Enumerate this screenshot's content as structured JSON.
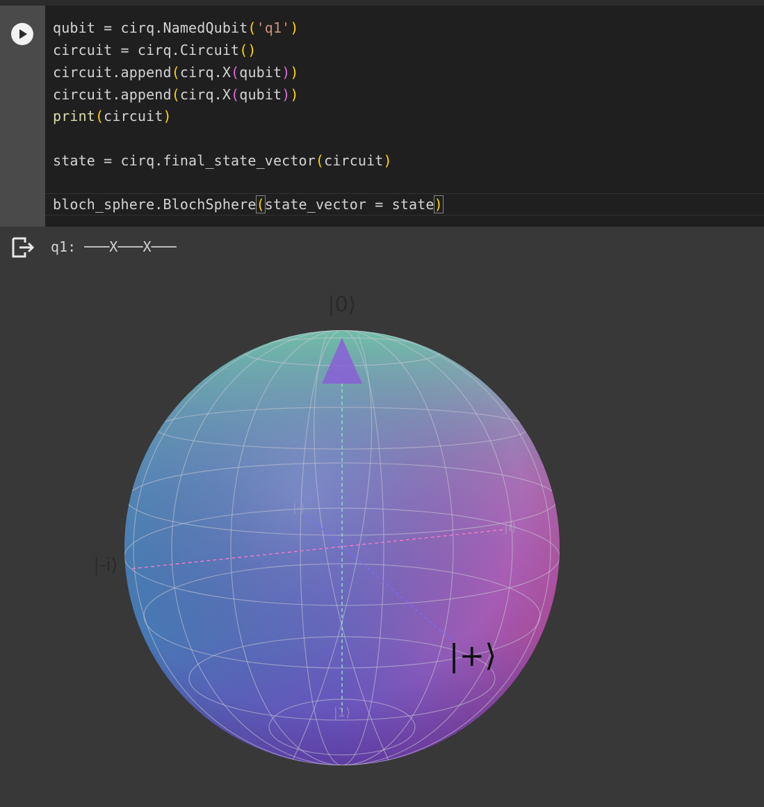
{
  "notebook": {
    "run_button_icon": "play-icon",
    "output_icon": "output-exit-icon"
  },
  "code": {
    "lines": [
      "qubit = cirq.NamedQubit('q1')",
      "circuit = cirq.Circuit()",
      "circuit.append(cirq.X(qubit))",
      "circuit.append(cirq.X(qubit))",
      "print(circuit)",
      "",
      "state = cirq.final_state_vector(circuit)",
      "",
      "bloch_sphere.BlochSphere(state_vector = state)"
    ]
  },
  "output": {
    "circuit_text": "q1: ───X───X───"
  },
  "bloch_sphere": {
    "labels": {
      "zero": "|0⟩",
      "plus": "|+⟩",
      "minus_i": "|-i⟩",
      "i": "|i⟩",
      "minus": "|-⟩",
      "one": "|1⟩"
    },
    "colors": {
      "top": "#6dbba8",
      "left": "#3f8fb0",
      "right": "#d35aa8",
      "bottom": "#6a39b8",
      "vector": "#8a5fd6"
    }
  }
}
